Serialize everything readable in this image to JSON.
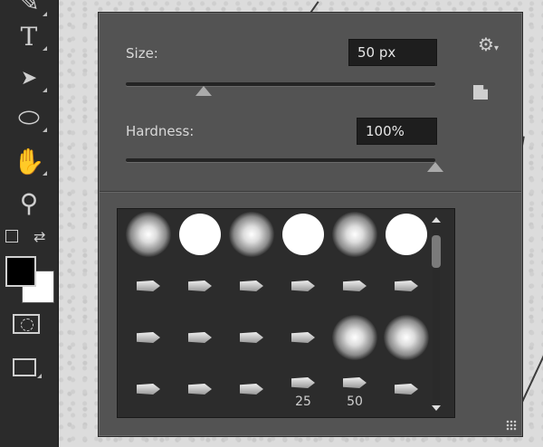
{
  "toolbar": {
    "tools": [
      {
        "name": "pen-icon",
        "glyph": "✎"
      },
      {
        "name": "type-tool-icon",
        "glyph": "T"
      },
      {
        "name": "path-selection-icon",
        "glyph": "➤"
      },
      {
        "name": "ellipse-tool-icon",
        "glyph": "⬭"
      },
      {
        "name": "hand-tool-icon",
        "glyph": "✋"
      },
      {
        "name": "zoom-tool-icon",
        "glyph": "⚲"
      }
    ],
    "foreground_color": "#000000",
    "background_color": "#ffffff"
  },
  "brush_panel": {
    "size_label": "Size:",
    "size_value": "50 px",
    "size_slider_fraction": 0.2,
    "hardness_label": "Hardness:",
    "hardness_value": "100%",
    "hardness_slider_fraction": 1.0,
    "settings_icon": "gear-icon",
    "new_preset_icon": "new-preset-icon",
    "brushes": [
      {
        "type": "soft"
      },
      {
        "type": "hard"
      },
      {
        "type": "soft"
      },
      {
        "type": "hard"
      },
      {
        "type": "soft"
      },
      {
        "type": "hard"
      },
      {
        "type": "tip"
      },
      {
        "type": "tip"
      },
      {
        "type": "tip"
      },
      {
        "type": "tip"
      },
      {
        "type": "tip"
      },
      {
        "type": "tip"
      },
      {
        "type": "tip"
      },
      {
        "type": "tip"
      },
      {
        "type": "tip"
      },
      {
        "type": "tip"
      },
      {
        "type": "soft"
      },
      {
        "type": "soft"
      },
      {
        "type": "tip"
      },
      {
        "type": "tip"
      },
      {
        "type": "tip"
      },
      {
        "type": "tip",
        "label": "25"
      },
      {
        "type": "tip",
        "label": "50"
      },
      {
        "type": "tip"
      }
    ]
  }
}
